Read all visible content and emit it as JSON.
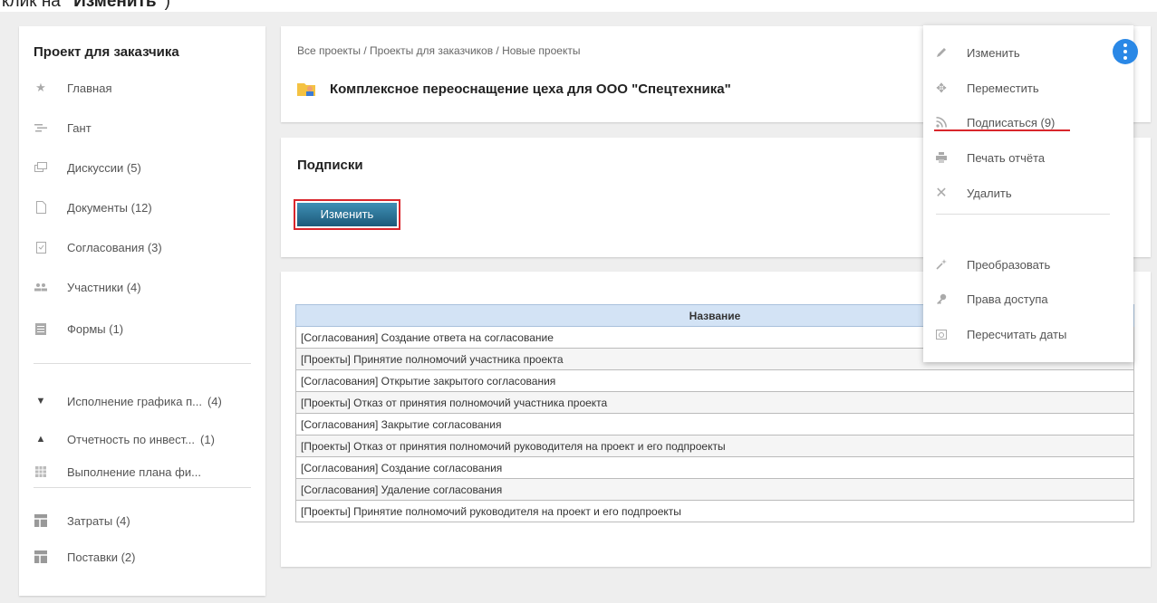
{
  "caption": {
    "prefix": "клик на ",
    "bold": "\"Изменить\"",
    "suffix": ")"
  },
  "sidebar": {
    "title": "Проект для заказчика",
    "items": [
      {
        "label": "Главная",
        "count": "",
        "icon": "star-icon"
      },
      {
        "label": "Гант",
        "count": "",
        "icon": "gantt-icon"
      },
      {
        "label": "Дискуссии (5)",
        "count": "",
        "icon": "discussion-icon"
      },
      {
        "label": "Документы (12)",
        "count": "",
        "icon": "document-icon"
      },
      {
        "label": "Согласования (3)",
        "count": "",
        "icon": "approval-icon"
      },
      {
        "label": "Участники (4)",
        "count": "",
        "icon": "people-icon"
      },
      {
        "label": "Формы (1)",
        "count": "",
        "icon": "form-icon"
      }
    ],
    "reports": [
      {
        "label": "Исполнение графика п...",
        "count": "(4)",
        "icon": "triangle-down-icon"
      },
      {
        "label": "Отчетность по инвест...",
        "count": "(1)",
        "icon": "triangle-up-icon"
      },
      {
        "label": "Выполнение плана фи...",
        "count": "",
        "icon": "grid-icon"
      }
    ],
    "extras": [
      {
        "label": "Затраты (4)",
        "icon": "table-icon"
      },
      {
        "label": "Поставки (2)",
        "icon": "table-icon"
      }
    ]
  },
  "header": {
    "breadcrumb": "Все проекты / Проекты для заказчиков / Новые проекты",
    "title": "Комплексное переоснащение цеха для ООО \"Спецтехника\""
  },
  "subscriptions": {
    "title": "Подписки",
    "edit_label": "Изменить"
  },
  "table": {
    "header": "Название",
    "rows": [
      "[Согласования] Создание ответа на согласование",
      "[Проекты] Принятие полномочий участника проекта",
      "[Согласования] Открытие закрытого согласования",
      "[Проекты] Отказ от принятия полномочий участника проекта",
      "[Согласования] Закрытие согласования",
      "[Проекты] Отказ от принятия полномочий руководителя на проект и его подпроекты",
      "[Согласования] Создание согласования",
      "[Согласования] Удаление согласования",
      "[Проекты] Принятие полномочий руководителя на проект и его подпроекты"
    ]
  },
  "menu": {
    "items": [
      {
        "label": "Изменить",
        "icon": "pencil-icon"
      },
      {
        "label": "Переместить",
        "icon": "move-icon"
      },
      {
        "label": "Подписаться (9)",
        "icon": "rss-icon"
      },
      {
        "label": "Печать отчёта",
        "icon": "print-icon"
      },
      {
        "label": "Удалить",
        "icon": "close-icon"
      },
      {
        "label": "Преобразовать",
        "icon": "magic-wand-icon"
      },
      {
        "label": "Права доступа",
        "icon": "key-icon"
      },
      {
        "label": "Пересчитать даты",
        "icon": "calendar-icon"
      }
    ]
  },
  "colors": {
    "accent": "#2a88e6",
    "highlight": "#d9262c",
    "button": "#1d5a7a"
  }
}
